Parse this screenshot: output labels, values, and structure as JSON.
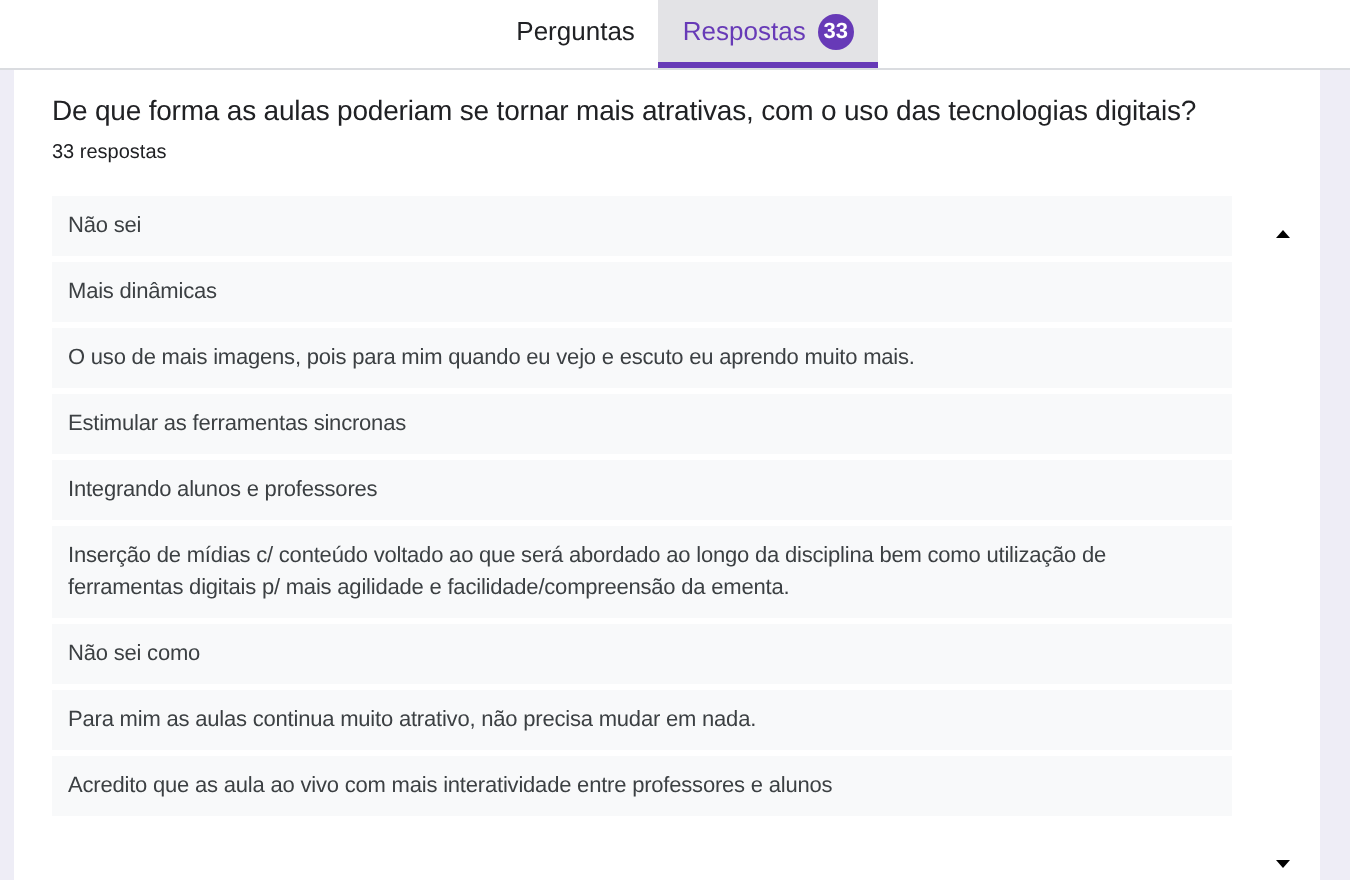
{
  "tabs": [
    {
      "label": "Perguntas",
      "selected": false
    },
    {
      "label": "Respostas",
      "selected": true,
      "badge": "33"
    }
  ],
  "question": {
    "title": "De que forma as aulas poderiam se tornar mais atrativas, com o uso das tecnologias digitais?",
    "count": "33 respostas"
  },
  "answers": [
    "Não sei",
    "Mais dinâmicas",
    "O uso de mais imagens, pois para mim quando eu vejo e escuto eu aprendo muito mais.",
    "Estimular as ferramentas sincronas",
    "Integrando alunos e professores",
    "Inserção de mídias c/ conteúdo voltado ao que será abordado ao longo da disciplina bem como utilização de ferramentas digitais p/ mais agilidade e facilidade/compreensão da ementa.",
    "Não sei como",
    "Para mim as aulas continua muito atrativo, não precisa mudar em nada.",
    "Acredito que as aula ao vivo com mais interatividade entre professores e alunos"
  ]
}
